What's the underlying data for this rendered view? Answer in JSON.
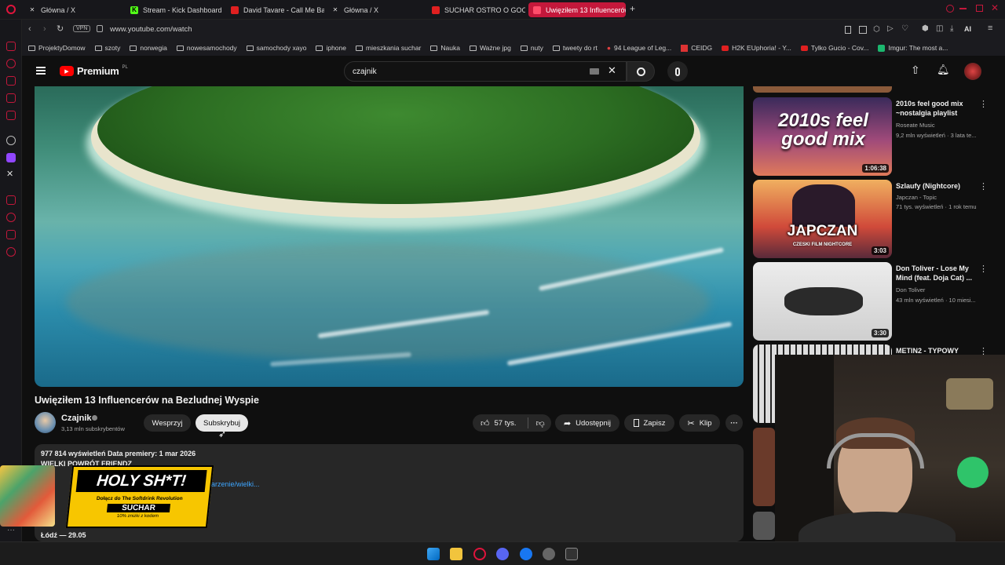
{
  "browser": {
    "tabs": [
      {
        "label": "Główna / X",
        "icon": "x-icon"
      },
      {
        "label": "Stream - Kick Dashboard",
        "icon": "kick-icon"
      },
      {
        "label": "David Tavare - Call Me Ba",
        "icon": "youtube-icon"
      },
      {
        "label": "Główna / X",
        "icon": "x-icon"
      },
      {
        "label": "SUCHAR OSTRO O GOOD",
        "icon": "youtube-icon"
      },
      {
        "label": "Uwięziłem 13 Influencerów",
        "icon": "youtube-icon",
        "active": true
      }
    ],
    "new_tab": "+",
    "url": "www.youtube.com/watch",
    "vpn": "VPN",
    "ai_label": "AI",
    "bookmarks": [
      "ProjektyDomow",
      "szoty",
      "norwegia",
      "nowesamochody",
      "samochody xayo",
      "iphone",
      "mieszkania suchar",
      "Nauka",
      "Ważne jpg",
      "nuty",
      "tweety do rt",
      "94 League of Leg...",
      "CEIDG",
      "H2K EUphoria! - Y...",
      "Tylko Gucio - Cov...",
      "Imgur: The most a..."
    ]
  },
  "youtube": {
    "logo": "Premium",
    "logo_sup": "PL",
    "search_value": "czajnik",
    "video_title": "Uwięziłem 13 Influencerów na Bezludnej Wyspie",
    "channel": {
      "name": "Czajnik",
      "subs": "3,13 mln subskrybentów"
    },
    "buttons": {
      "support": "Wesprzyj",
      "subscribe": "Subskrybuj",
      "likes": "57 tys.",
      "share": "Udostępnij",
      "save": "Zapisz",
      "clip": "Klip"
    },
    "description": {
      "stats": "977 814 wyświetleń  Data premiery: 1 mar 2026",
      "line1": "WIELKI POWRÓT FRIENDZ",
      "link": "darzenie/wielki...",
      "footer": "Łódź — 29.05"
    },
    "overlay": {
      "headline": "HOLY SH*T!",
      "line1": "Dołącz do The Softdrink Revolution",
      "code": "SUCHAR",
      "line2": "10% zniżki z kodem"
    },
    "recommendations": [
      {
        "title": "2010s feel good mix ~nostalgia playlist",
        "channel": "Roseate Music",
        "meta": "9,2 mln wyświetleń · 3 lata te...",
        "duration": "1:06:38",
        "thumb_text": "2010s feel good mix"
      },
      {
        "title": "Szlaufy (Nightcore)",
        "channel": "Japczan - Topic",
        "meta": "71 tys. wyświetleń · 1 rok temu",
        "duration": "3:03",
        "thumb_text": "JAPCZAN",
        "thumb_sub": "CZESKI FILM NIGHTCORE"
      },
      {
        "title": "Don Toliver - Lose My Mind (feat. Doja Cat) ...",
        "channel": "Don Toliver",
        "meta": "43 mln wyświetleń · 10 miesi...",
        "duration": "3:30"
      },
      {
        "title": "METIN2 - TYPOWY",
        "channel": "",
        "meta": ""
      }
    ]
  }
}
